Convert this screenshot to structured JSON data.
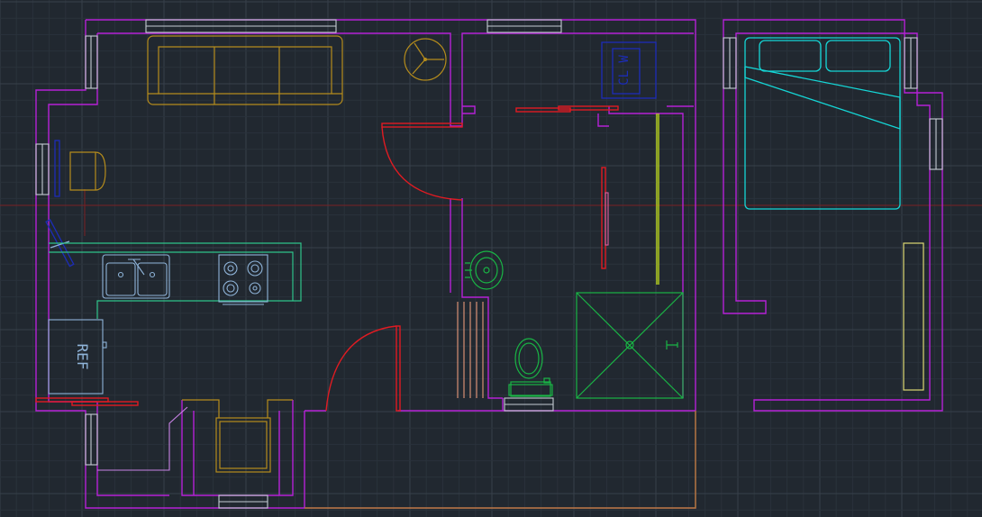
{
  "drawing": {
    "background_color": "#212830",
    "layer_colors": {
      "walls": "#b521d6",
      "doors": "#e01b22",
      "windows": "#c5cbd3",
      "living_furniture": "#b58c1c",
      "bed": "#15d6d6",
      "bathroom_fixtures": "#19b545",
      "appliances": "#8fb4d9",
      "washer_dryer": "#1c2cb8"
    },
    "labels": {
      "washer_dryer_label": "CL W",
      "fridge_label": "REF"
    },
    "icons": [
      "sofa",
      "armchair",
      "round-table",
      "double-sink",
      "cooktop",
      "refrigerator",
      "washer-dryer",
      "lavatory",
      "toilet",
      "shower",
      "bed",
      "wardrobe"
    ]
  }
}
